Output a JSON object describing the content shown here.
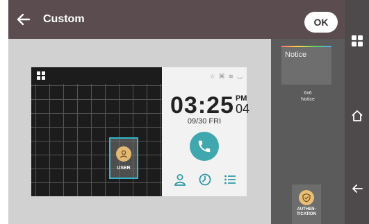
{
  "header": {
    "title": "Custom",
    "ok_label": "OK",
    "back_icon": "arrow-left-icon"
  },
  "preview": {
    "grid_apps_icon": "apps-grid-icon",
    "user_tile_label": "USER",
    "status_icons": [
      "star-icon",
      "signal-icon",
      "wifi-icon",
      "nfc-icon"
    ],
    "clock": {
      "time": "03:25",
      "ampm": "PM",
      "seconds": "04"
    },
    "date": "09/30 FRI",
    "call_icon": "phone-icon",
    "bottom_icons": [
      "user-icon",
      "clock-icon",
      "list-icon"
    ]
  },
  "widgets": {
    "notice_card_label": "Notice",
    "notice_size": "6x6",
    "notice_name": "Notice",
    "auth_label_line1": "AUTHEN-",
    "auth_label_line2": "TICATION",
    "auth_icon": "shield-check-icon"
  },
  "nav": {
    "items": [
      "apps-grid-icon",
      "home-icon",
      "back-icon"
    ]
  },
  "colors": {
    "header_bg": "#5a4c4f",
    "accent_teal": "#3fa7ad",
    "selection_border": "#33b6c9",
    "user_avatar": "#e3b872",
    "auth_badge": "#e9be77"
  }
}
